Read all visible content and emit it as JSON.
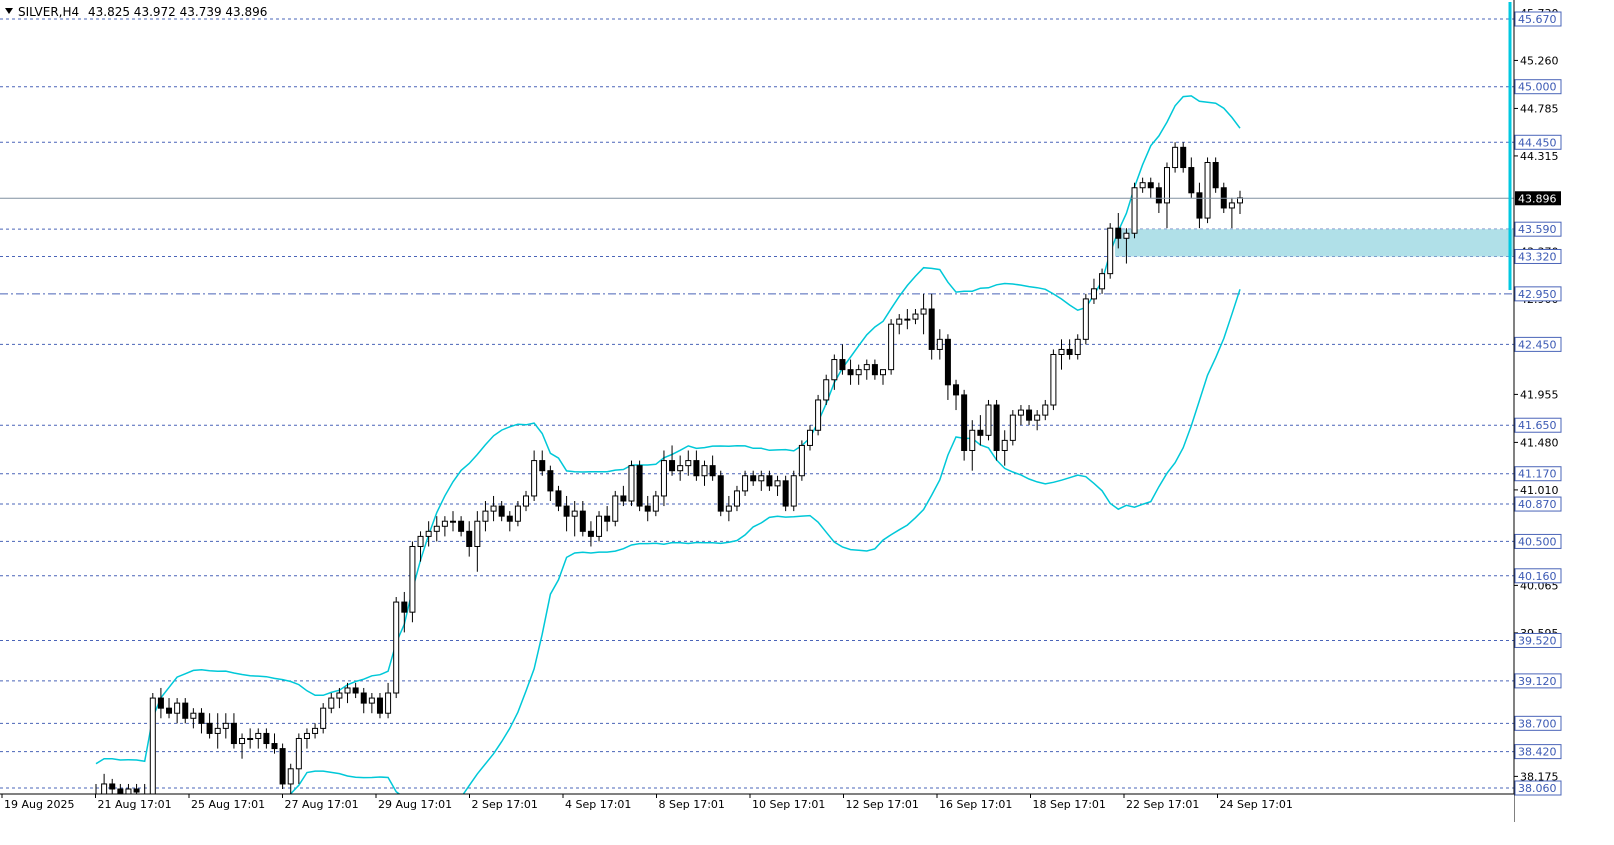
{
  "header": {
    "symbol": "SILVER,H4",
    "ohlc": "43.825 43.972 43.739 43.896"
  },
  "chart_data": {
    "type": "candlestick",
    "symbol": "SILVER",
    "timeframe": "H4",
    "current_price": "43.896",
    "y_axis_labels": [
      "45.730",
      "45.260",
      "44.785",
      "44.315",
      "43.370",
      "42.900",
      "41.955",
      "41.480",
      "41.010",
      "40.535",
      "40.065",
      "39.595",
      "38.175"
    ],
    "level_labels": [
      "45.670",
      "45.000",
      "44.450",
      "43.590",
      "43.320",
      "42.950",
      "42.450",
      "41.650",
      "41.170",
      "40.870",
      "40.500",
      "40.160",
      "39.520",
      "39.120",
      "38.700",
      "38.420",
      "38.060"
    ],
    "level_values": [
      45.67,
      45.0,
      44.45,
      43.59,
      43.32,
      42.95,
      42.45,
      41.65,
      41.17,
      40.87,
      40.5,
      40.16,
      39.52,
      39.12,
      38.7,
      38.42,
      38.06
    ],
    "dash_dot_level": 42.95,
    "support_zone": [
      43.32,
      43.59
    ],
    "x_axis_labels": [
      "19 Aug 2025",
      "21 Aug 17:01",
      "25 Aug 17:01",
      "27 Aug 17:01",
      "29 Aug 17:01",
      "2 Sep 17:01",
      "4 Sep 17:01",
      "8 Sep 17:01",
      "10 Sep 17:01",
      "12 Sep 17:01",
      "16 Sep 17:01",
      "18 Sep 17:01",
      "22 Sep 17:01",
      "24 Sep 17:01"
    ],
    "indicator": "Bollinger Bands",
    "colors": {
      "band": "#00c8d8",
      "zone": "#b0e0e8",
      "level": "#3c5ab4",
      "axis_line": "#00c8e0",
      "price_box": "#000000"
    },
    "candles": [
      [
        37.9,
        38.1,
        37.8,
        38.0
      ],
      [
        38.0,
        38.2,
        37.9,
        38.1
      ],
      [
        38.1,
        38.15,
        38.0,
        38.05
      ],
      [
        38.05,
        38.1,
        37.95,
        38.0
      ],
      [
        38.0,
        38.1,
        37.9,
        38.05
      ],
      [
        38.05,
        38.1,
        37.98,
        38.02
      ],
      [
        38.0,
        38.1,
        37.9,
        37.95
      ],
      [
        37.95,
        39.0,
        37.9,
        38.95
      ],
      [
        38.95,
        39.05,
        38.75,
        38.85
      ],
      [
        38.85,
        38.95,
        38.75,
        38.8
      ],
      [
        38.8,
        38.95,
        38.7,
        38.9
      ],
      [
        38.9,
        38.95,
        38.7,
        38.75
      ],
      [
        38.75,
        38.85,
        38.65,
        38.8
      ],
      [
        38.8,
        38.85,
        38.6,
        38.7
      ],
      [
        38.7,
        38.8,
        38.55,
        38.6
      ],
      [
        38.6,
        38.8,
        38.45,
        38.65
      ],
      [
        38.65,
        38.8,
        38.55,
        38.7
      ],
      [
        38.7,
        38.8,
        38.45,
        38.5
      ],
      [
        38.5,
        38.6,
        38.35,
        38.55
      ],
      [
        38.55,
        38.65,
        38.45,
        38.55
      ],
      [
        38.55,
        38.65,
        38.45,
        38.6
      ],
      [
        38.6,
        38.65,
        38.45,
        38.5
      ],
      [
        38.5,
        38.6,
        38.4,
        38.45
      ],
      [
        38.45,
        38.5,
        38.05,
        38.1
      ],
      [
        38.1,
        38.3,
        38.0,
        38.25
      ],
      [
        38.25,
        38.6,
        38.1,
        38.55
      ],
      [
        38.55,
        38.65,
        38.45,
        38.6
      ],
      [
        38.6,
        38.7,
        38.55,
        38.65
      ],
      [
        38.65,
        38.9,
        38.6,
        38.85
      ],
      [
        38.85,
        39.0,
        38.8,
        38.95
      ],
      [
        38.95,
        39.05,
        38.85,
        39.0
      ],
      [
        39.0,
        39.1,
        38.9,
        39.05
      ],
      [
        39.05,
        39.1,
        38.95,
        39.0
      ],
      [
        39.0,
        39.05,
        38.8,
        38.9
      ],
      [
        38.9,
        39.0,
        38.8,
        38.95
      ],
      [
        38.95,
        39.0,
        38.75,
        38.8
      ],
      [
        38.8,
        39.1,
        38.75,
        39.0
      ],
      [
        39.0,
        39.95,
        38.95,
        39.9
      ],
      [
        39.9,
        40.0,
        39.6,
        39.8
      ],
      [
        39.8,
        40.5,
        39.7,
        40.45
      ],
      [
        40.45,
        40.6,
        40.3,
        40.55
      ],
      [
        40.55,
        40.7,
        40.45,
        40.6
      ],
      [
        40.6,
        40.75,
        40.5,
        40.65
      ],
      [
        40.65,
        40.75,
        40.55,
        40.7
      ],
      [
        40.7,
        40.8,
        40.6,
        40.7
      ],
      [
        40.7,
        40.75,
        40.55,
        40.6
      ],
      [
        40.6,
        40.7,
        40.35,
        40.45
      ],
      [
        40.45,
        40.8,
        40.2,
        40.7
      ],
      [
        40.7,
        40.9,
        40.6,
        40.8
      ],
      [
        40.8,
        40.95,
        40.7,
        40.85
      ],
      [
        40.85,
        40.9,
        40.7,
        40.75
      ],
      [
        40.75,
        40.8,
        40.6,
        40.7
      ],
      [
        40.7,
        40.9,
        40.65,
        40.85
      ],
      [
        40.85,
        41.0,
        40.8,
        40.95
      ],
      [
        40.95,
        41.4,
        40.9,
        41.3
      ],
      [
        41.3,
        41.4,
        41.15,
        41.2
      ],
      [
        41.2,
        41.25,
        40.9,
        41.0
      ],
      [
        41.0,
        41.05,
        40.8,
        40.85
      ],
      [
        40.85,
        40.95,
        40.6,
        40.75
      ],
      [
        40.75,
        40.9,
        40.55,
        40.8
      ],
      [
        40.8,
        40.9,
        40.55,
        40.6
      ],
      [
        40.6,
        40.7,
        40.45,
        40.55
      ],
      [
        40.55,
        40.8,
        40.5,
        40.75
      ],
      [
        40.75,
        40.85,
        40.6,
        40.7
      ],
      [
        40.7,
        41.0,
        40.65,
        40.95
      ],
      [
        40.95,
        41.05,
        40.85,
        40.9
      ],
      [
        40.9,
        41.3,
        40.85,
        41.25
      ],
      [
        41.25,
        41.3,
        40.8,
        40.85
      ],
      [
        40.85,
        40.95,
        40.7,
        40.8
      ],
      [
        40.8,
        41.0,
        40.75,
        40.95
      ],
      [
        40.95,
        41.4,
        40.85,
        41.3
      ],
      [
        41.3,
        41.45,
        41.15,
        41.2
      ],
      [
        41.2,
        41.35,
        41.1,
        41.25
      ],
      [
        41.25,
        41.4,
        41.15,
        41.3
      ],
      [
        41.3,
        41.4,
        41.1,
        41.15
      ],
      [
        41.15,
        41.3,
        41.05,
        41.25
      ],
      [
        41.25,
        41.35,
        41.1,
        41.15
      ],
      [
        41.15,
        41.2,
        40.75,
        40.8
      ],
      [
        40.8,
        40.95,
        40.7,
        40.85
      ],
      [
        40.85,
        41.05,
        40.8,
        41.0
      ],
      [
        41.0,
        41.2,
        40.95,
        41.15
      ],
      [
        41.15,
        41.2,
        41.05,
        41.1
      ],
      [
        41.1,
        41.2,
        41.0,
        41.15
      ],
      [
        41.15,
        41.2,
        41.0,
        41.05
      ],
      [
        41.05,
        41.15,
        40.95,
        41.1
      ],
      [
        41.1,
        41.15,
        40.8,
        40.85
      ],
      [
        40.85,
        41.2,
        40.8,
        41.15
      ],
      [
        41.15,
        41.5,
        41.1,
        41.45
      ],
      [
        41.45,
        41.65,
        41.4,
        41.6
      ],
      [
        41.6,
        41.95,
        41.55,
        41.9
      ],
      [
        41.9,
        42.15,
        41.85,
        42.1
      ],
      [
        42.1,
        42.35,
        42.0,
        42.3
      ],
      [
        42.3,
        42.45,
        42.15,
        42.2
      ],
      [
        42.2,
        42.3,
        42.05,
        42.15
      ],
      [
        42.15,
        42.25,
        42.05,
        42.2
      ],
      [
        42.2,
        42.3,
        42.1,
        42.25
      ],
      [
        42.25,
        42.3,
        42.1,
        42.15
      ],
      [
        42.15,
        42.2,
        42.05,
        42.2
      ],
      [
        42.2,
        42.7,
        42.15,
        42.65
      ],
      [
        42.65,
        42.75,
        42.55,
        42.7
      ],
      [
        42.7,
        42.8,
        42.6,
        42.7
      ],
      [
        42.7,
        42.8,
        42.65,
        42.75
      ],
      [
        42.75,
        42.95,
        42.55,
        42.8
      ],
      [
        42.8,
        42.95,
        42.3,
        42.4
      ],
      [
        42.4,
        42.6,
        42.3,
        42.5
      ],
      [
        42.5,
        42.55,
        41.9,
        42.05
      ],
      [
        42.05,
        42.1,
        41.8,
        41.95
      ],
      [
        41.95,
        42.0,
        41.3,
        41.4
      ],
      [
        41.4,
        41.7,
        41.2,
        41.6
      ],
      [
        41.6,
        41.75,
        41.45,
        41.55
      ],
      [
        41.55,
        41.9,
        41.5,
        41.85
      ],
      [
        41.85,
        41.9,
        41.3,
        41.4
      ],
      [
        41.4,
        41.6,
        41.25,
        41.5
      ],
      [
        41.5,
        41.8,
        41.45,
        41.75
      ],
      [
        41.75,
        41.85,
        41.65,
        41.8
      ],
      [
        41.8,
        41.85,
        41.65,
        41.7
      ],
      [
        41.7,
        41.8,
        41.6,
        41.75
      ],
      [
        41.75,
        41.9,
        41.7,
        41.85
      ],
      [
        41.85,
        42.4,
        41.8,
        42.35
      ],
      [
        42.35,
        42.5,
        42.2,
        42.4
      ],
      [
        42.4,
        42.5,
        42.3,
        42.35
      ],
      [
        42.35,
        42.55,
        42.3,
        42.5
      ],
      [
        42.5,
        42.95,
        42.45,
        42.9
      ],
      [
        42.9,
        43.1,
        42.85,
        43.0
      ],
      [
        43.0,
        43.2,
        42.95,
        43.15
      ],
      [
        43.15,
        43.65,
        43.1,
        43.6
      ],
      [
        43.6,
        43.75,
        43.4,
        43.5
      ],
      [
        43.5,
        43.6,
        43.25,
        43.55
      ],
      [
        43.55,
        44.05,
        43.5,
        44.0
      ],
      [
        44.0,
        44.1,
        43.95,
        44.05
      ],
      [
        44.05,
        44.1,
        43.9,
        44.0
      ],
      [
        44.0,
        44.05,
        43.75,
        43.85
      ],
      [
        43.85,
        44.25,
        43.6,
        44.2
      ],
      [
        44.2,
        44.45,
        44.15,
        44.4
      ],
      [
        44.4,
        44.45,
        44.15,
        44.2
      ],
      [
        44.2,
        44.3,
        43.9,
        43.95
      ],
      [
        43.95,
        44.05,
        43.6,
        43.7
      ],
      [
        43.7,
        44.3,
        43.65,
        44.25
      ],
      [
        44.25,
        44.3,
        43.95,
        44.0
      ],
      [
        44.0,
        44.05,
        43.75,
        43.8
      ],
      [
        43.8,
        43.9,
        43.6,
        43.85
      ],
      [
        43.85,
        43.97,
        43.74,
        43.9
      ]
    ]
  }
}
